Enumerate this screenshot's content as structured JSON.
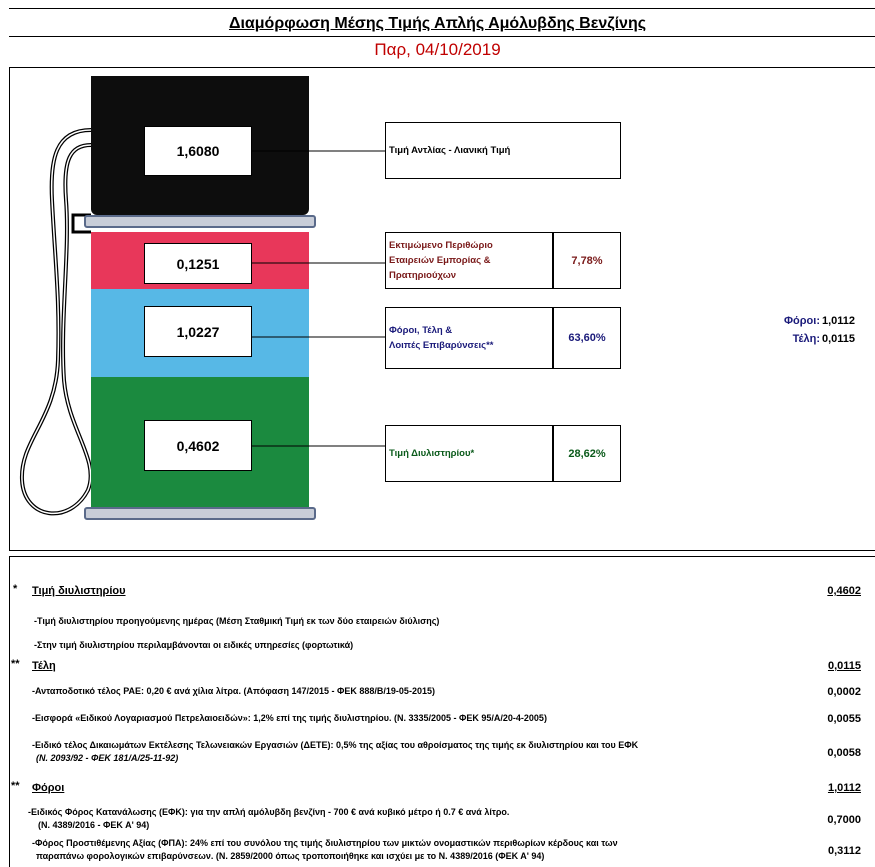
{
  "header": {
    "title": "Διαμόρφωση Μέσης Τιμής Απλής Αμόλυβδης Βενζίνης",
    "date": "Παρ, 04/10/2019"
  },
  "pump": {
    "retail_value": "1,6080",
    "margin_value": "0,1251",
    "taxes_value": "1,0227",
    "refinery_value": "0,4602"
  },
  "labels": {
    "retail": "Τιμή Αντλίας - Λιανική Τιμή",
    "margin_line1": "Εκτιμώμενο Περιθώριο",
    "margin_line2": "Εταιρειών Εμπορίας &",
    "margin_line3": "Πρατηριούχων",
    "margin_pct": "7,78%",
    "taxes_line1": "Φόροι, Τέλη &",
    "taxes_line2": "Λοιπές Επιβαρύνσεις**",
    "taxes_pct": "63,60%",
    "refinery": "Τιμή Διυλιστηρίου*",
    "refinery_pct": "28,62%"
  },
  "side": {
    "taxes_label": "Φόροι:",
    "taxes_value": "1,0112",
    "fees_label": "Τέλη:",
    "fees_value": "0,0115"
  },
  "details": {
    "refinery": {
      "star": "*",
      "title": "Τιμή διυλιστηρίου",
      "value": "0,4602",
      "note1": "-Τιμή διυλιστηρίου προηγούμενης ημέρας (Μέση Σταθμική Τιμή εκ των δύο εταιρειών διύλισης)",
      "note2": "-Στην τιμή διυλιστηρίου περιλαμβάνονται οι ειδικές υπηρεσίες (φορτωτικά)"
    },
    "fees": {
      "star": "**",
      "title": "Τέλη",
      "value": "0,0115",
      "items": [
        {
          "text": "-Ανταποδοτικό τέλος ΡΑΕ: 0,20 € ανά χίλια λίτρα. (Απόφαση 147/2015 - ΦΕΚ 888/Β/19-05-2015)",
          "value": "0,0002"
        },
        {
          "text": "-Εισφορά «Ειδικού Λογαριασμού Πετρελαιοειδών»: 1,2% επί της τιμής διυλιστηρίου. (Ν. 3335/2005 - ΦΕΚ 95/Α/20-4-2005)",
          "value": "0,0055"
        },
        {
          "text": "-Ειδικό τέλος Δικαιωμάτων Εκτέλεσης Τελωνειακών Εργασιών (ΔΕΤΕ): 0,5% της αξίας του αθροίσματος της τιμής εκ διυλιστηρίου και του ΕΦΚ",
          "text2": "(Ν. 2093/92 - ΦΕΚ 181/Α/25-11-92)",
          "value": "0,0058"
        }
      ]
    },
    "taxes": {
      "star": "**",
      "title": "Φόροι",
      "value": "1,0112",
      "items": [
        {
          "text": "-Ειδικός Φόρος Κατανάλωσης (ΕΦΚ): για την απλή αμόλυβδη βενζίνη - 700 € ανά κυβικό μέτρο ή 0.7 € ανά λίτρο.",
          "text2": "(Ν. 4389/2016 - ΦΕΚ Α' 94)",
          "value": "0,7000"
        },
        {
          "text": "-Φόρος Προστιθέμενης Αξίας (ΦΠΑ): 24% επί του συνόλου της τιμής διυλιστηρίου των μικτών ονομαστικών περιθωρίων κέρδους και των",
          "text2": "παραπάνω φορολογικών επιβαρύνσεων. (Ν. 2859/2000 όπως τροποποιήθηκε και ισχύει με το Ν. 4389/2016 (ΦΕΚ Α' 94)",
          "value": "0,3112"
        }
      ]
    }
  },
  "colors": {
    "date": "#c00000",
    "black": "#0d0d0d",
    "red": "#e8375a",
    "blue": "#57b8e6",
    "green": "#1b8a3f",
    "margin_text": "#7a1a1a",
    "taxes_text": "#1a1a7a",
    "refinery_text": "#0a5a1a"
  }
}
